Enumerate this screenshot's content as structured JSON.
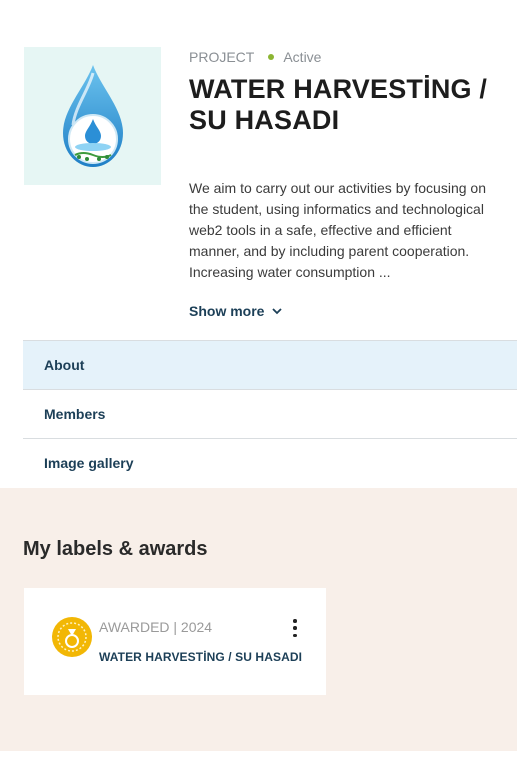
{
  "project": {
    "type_label": "PROJECT",
    "status": "Active",
    "title": "WATER HARVESTİNG / SU HASADI",
    "description": "We aim to carry out our activities by focusing on the student, using informatics and technological web2 tools in a safe, effective and efficient manner, and by including parent cooperation. Increasing water consumption ...",
    "show_more": "Show more",
    "logo_icon": "water-drop-logo",
    "status_color": "#8cb532"
  },
  "tabs": [
    {
      "label": "About",
      "active": true
    },
    {
      "label": "Members",
      "active": false
    },
    {
      "label": "Image gallery",
      "active": false
    }
  ],
  "labels_section": {
    "heading": "My labels & awards",
    "awards": [
      {
        "meta": "AWARDED | 2024",
        "name": "WATER HARVESTİNG / SU HASADI",
        "icon": "award-badge-icon"
      }
    ]
  },
  "colors": {
    "accent_text": "#1c3f57",
    "section_bg": "#f8efe9",
    "active_tab_bg": "#e5f2fa",
    "badge": "#f2b705"
  }
}
